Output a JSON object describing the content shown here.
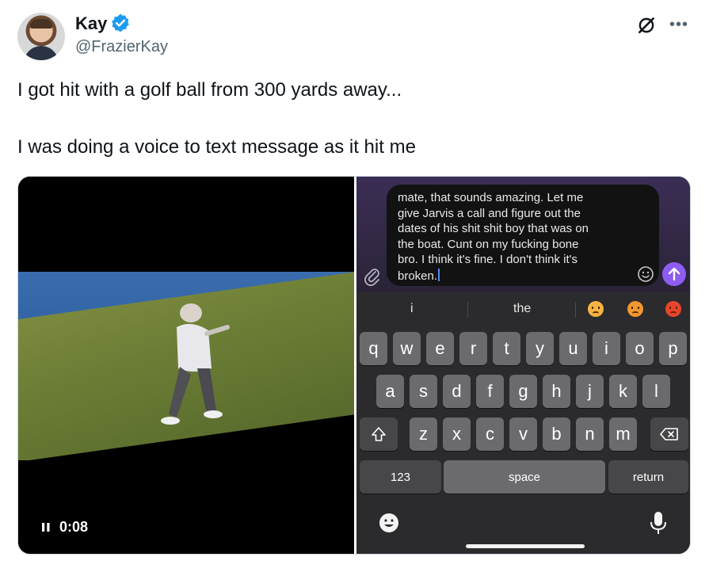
{
  "author": {
    "display_name": "Kay",
    "handle": "@FrazierKay",
    "verified_icon": "verified-badge-icon",
    "verified_color": "#1d9bf0"
  },
  "header_icons": [
    "grok-icon",
    "more-icon"
  ],
  "tweet": {
    "line1": "I got hit with a golf ball from 300 yards away...",
    "line2": "I was doing a voice to text message as it hit me"
  },
  "video": {
    "duration": "0:08",
    "control_icon": "pause-icon"
  },
  "phone": {
    "message_lines": [
      "mate, that sounds amazing. Let me",
      "give Jarvis a call and figure out the",
      "dates of his shit shit boy that was on",
      "the boat. Cunt on my fucking bone",
      "bro. I think it's fine. I don't think it's",
      "broken."
    ],
    "suggestions": [
      "i",
      "the"
    ],
    "suggestion_emojis": [
      "disappointed-face-icon",
      "angry-face-icon",
      "pouting-face-icon"
    ],
    "keyboard": {
      "row1": [
        "q",
        "w",
        "e",
        "r",
        "t",
        "y",
        "u",
        "i",
        "o",
        "p"
      ],
      "row2": [
        "a",
        "s",
        "d",
        "f",
        "g",
        "h",
        "j",
        "k",
        "l"
      ],
      "row3": [
        "z",
        "x",
        "c",
        "v",
        "b",
        "n",
        "m"
      ],
      "numbers_label": "123",
      "space_label": "space",
      "return_label": "return"
    },
    "send_color": "#8e5cf0"
  }
}
